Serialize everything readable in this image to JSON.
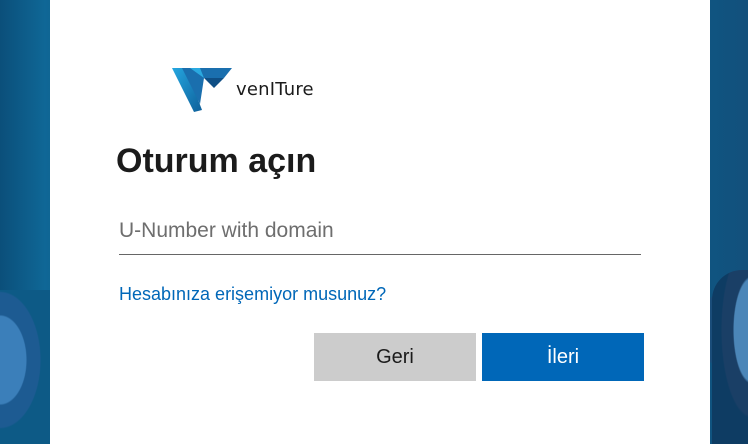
{
  "brand": {
    "name": "venITure"
  },
  "signin": {
    "title": "Oturum açın",
    "username_placeholder": "U-Number with domain",
    "username_value": "",
    "cant_access_link": "Hesabınıza erişemiyor musunuz?",
    "back_label": "Geri",
    "next_label": "İleri"
  },
  "colors": {
    "accent": "#0067b8",
    "back_button": "#cccccc",
    "background": "#0d5a86",
    "logo_blue": "#1e88c8"
  }
}
